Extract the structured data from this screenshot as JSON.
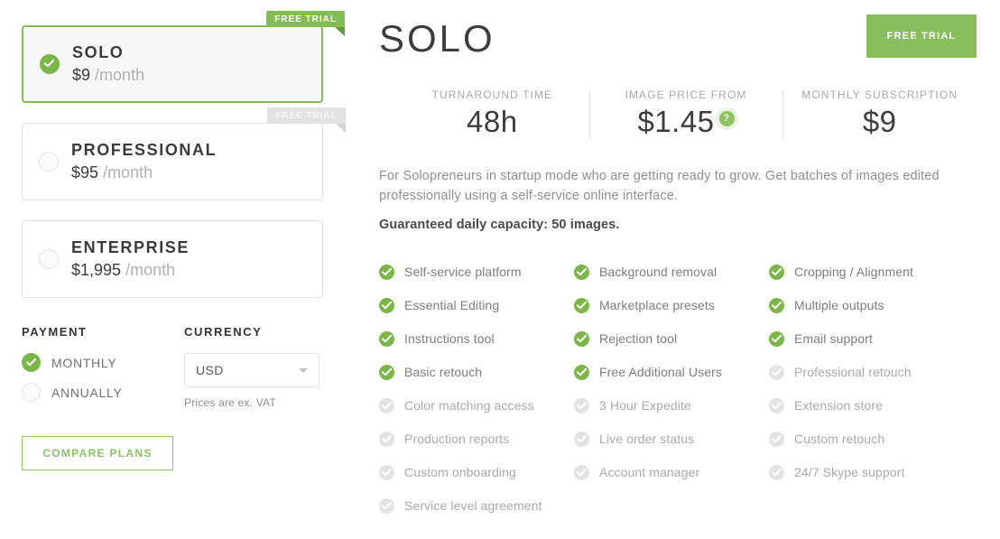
{
  "plans": [
    {
      "name": "SOLO",
      "price": "$9",
      "per": "/month",
      "selected": true,
      "ribbon": "FREE TRIAL",
      "ribbon_active": true
    },
    {
      "name": "PROFESSIONAL",
      "price": "$95",
      "per": "/month",
      "selected": false,
      "ribbon": "FREE TRIAL",
      "ribbon_active": false
    },
    {
      "name": "ENTERPRISE",
      "price": "$1,995",
      "per": "/month",
      "selected": false,
      "ribbon": null,
      "ribbon_active": false
    }
  ],
  "payment": {
    "label": "PAYMENT",
    "options": [
      {
        "label": "MONTHLY",
        "selected": true
      },
      {
        "label": "ANNUALLY",
        "selected": false
      }
    ]
  },
  "currency": {
    "label": "CURRENCY",
    "selected": "USD",
    "options": [
      "USD"
    ],
    "note": "Prices are ex. VAT"
  },
  "compare_button": "COMPARE PLANS",
  "detail": {
    "title": "SOLO",
    "trial_button": "FREE TRIAL",
    "stats": [
      {
        "label": "TURNAROUND TIME",
        "value": "48h",
        "help": false
      },
      {
        "label": "IMAGE PRICE FROM",
        "value": "$1.45",
        "help": true,
        "help_glyph": "?"
      },
      {
        "label": "MONTHLY SUBSCRIPTION",
        "value": "$9",
        "help": false
      }
    ],
    "description": "For Solopreneurs in startup mode who are getting ready to grow. Get batches of images edited professionally using a self-service online interface.",
    "capacity": "Guaranteed daily capacity: 50 images.",
    "feature_columns": [
      [
        {
          "label": "Self-service platform",
          "included": true
        },
        {
          "label": "Essential Editing",
          "included": true
        },
        {
          "label": "Instructions tool",
          "included": true
        },
        {
          "label": "Basic retouch",
          "included": true
        },
        {
          "label": "Color matching access",
          "included": false
        },
        {
          "label": "Production reports",
          "included": false
        },
        {
          "label": "Custom onboarding",
          "included": false
        },
        {
          "label": "Service level agreement",
          "included": false
        }
      ],
      [
        {
          "label": "Background removal",
          "included": true
        },
        {
          "label": "Marketplace presets",
          "included": true
        },
        {
          "label": "Rejection tool",
          "included": true
        },
        {
          "label": "Free Additional Users",
          "included": true
        },
        {
          "label": "3 Hour Expedite",
          "included": false
        },
        {
          "label": "Live order status",
          "included": false
        },
        {
          "label": "Account manager",
          "included": false
        }
      ],
      [
        {
          "label": "Cropping / Alignment",
          "included": true
        },
        {
          "label": "Multiple outputs",
          "included": true
        },
        {
          "label": "Email support",
          "included": true
        },
        {
          "label": "Professional retouch",
          "included": false
        },
        {
          "label": "Extension store",
          "included": false
        },
        {
          "label": "Custom retouch",
          "included": false
        },
        {
          "label": "24/7 Skype support",
          "included": false
        }
      ]
    ]
  },
  "colors": {
    "accent_green": "#7ab648",
    "button_green": "#88be5b",
    "ribbon_green": "#82bc52",
    "ribbon_fold": "#63993a",
    "muted_gray": "#e2e2e2"
  }
}
